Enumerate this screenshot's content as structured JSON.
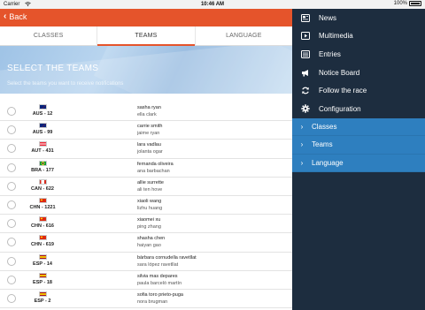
{
  "status_bar": {
    "carrier": "Carrier",
    "time": "10:46 AM",
    "battery": "100%"
  },
  "nav": {
    "back_label": "Back"
  },
  "tabs": [
    {
      "label": "CLASSES",
      "active": false
    },
    {
      "label": "TEAMS",
      "active": true
    },
    {
      "label": "LANGUAGE",
      "active": false
    }
  ],
  "hero": {
    "title": "SELECT THE TEAMS",
    "subtitle": "Select the teams you want to receive notifications"
  },
  "teams": [
    {
      "country": "AUS",
      "code": "AUS - 12",
      "skipper": "sasha ryan",
      "crew": "ella clark"
    },
    {
      "country": "AUS",
      "code": "AUS - 99",
      "skipper": "carrie smith",
      "crew": "jaime ryan"
    },
    {
      "country": "AUT",
      "code": "AUT - 431",
      "skipper": "lara vadlau",
      "crew": "jolanta ogar"
    },
    {
      "country": "BRA",
      "code": "BRA - 177",
      "skipper": "fernanda oliveira",
      "crew": "ana barbachan"
    },
    {
      "country": "CAN",
      "code": "CAN - 622",
      "skipper": "allie surrette",
      "crew": "ali ten hove"
    },
    {
      "country": "CHN",
      "code": "CHN - 1221",
      "skipper": "xiaoli wang",
      "crew": "lizhu huang"
    },
    {
      "country": "CHN",
      "code": "CHN - 616",
      "skipper": "xiaomei xu",
      "crew": "ping zhang"
    },
    {
      "country": "CHN",
      "code": "CHN - 619",
      "skipper": "shasha chen",
      "crew": "haiyan gao"
    },
    {
      "country": "ESP",
      "code": "ESP - 14",
      "skipper": "bàrbara cornudella ravetllat",
      "crew": "sara lópez ravetllat"
    },
    {
      "country": "ESP",
      "code": "ESP - 18",
      "skipper": "silvia mas depares",
      "crew": "paula barceló martín"
    },
    {
      "country": "ESP",
      "code": "ESP - 2",
      "skipper": "sofia toro prieto-puga",
      "crew": "nora brugman"
    }
  ],
  "side_menu": {
    "items": [
      {
        "label": "News",
        "icon": "news-icon"
      },
      {
        "label": "Multimedia",
        "icon": "play-icon"
      },
      {
        "label": "Entries",
        "icon": "list-icon"
      },
      {
        "label": "Notice Board",
        "icon": "megaphone-icon"
      },
      {
        "label": "Follow the race",
        "icon": "refresh-icon"
      },
      {
        "label": "Configuration",
        "icon": "gear-icon"
      }
    ],
    "sections": [
      {
        "label": "Classes"
      },
      {
        "label": "Teams"
      },
      {
        "label": "Language"
      }
    ]
  },
  "colors": {
    "accent": "#e5542b",
    "menu_bg": "#1d2d3f",
    "menu_section_bg": "#2e7fbf"
  }
}
